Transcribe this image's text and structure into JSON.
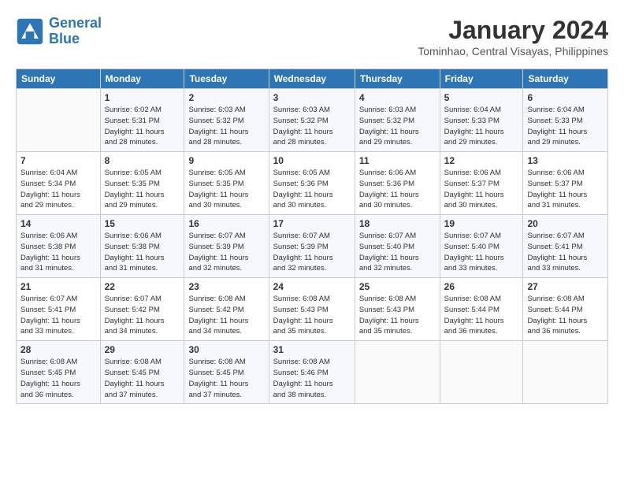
{
  "header": {
    "logo_line1": "General",
    "logo_line2": "Blue",
    "title": "January 2024",
    "subtitle": "Tominhao, Central Visayas, Philippines"
  },
  "columns": [
    "Sunday",
    "Monday",
    "Tuesday",
    "Wednesday",
    "Thursday",
    "Friday",
    "Saturday"
  ],
  "weeks": [
    [
      {
        "day": "",
        "info": ""
      },
      {
        "day": "1",
        "info": "Sunrise: 6:02 AM\nSunset: 5:31 PM\nDaylight: 11 hours\nand 28 minutes."
      },
      {
        "day": "2",
        "info": "Sunrise: 6:03 AM\nSunset: 5:32 PM\nDaylight: 11 hours\nand 28 minutes."
      },
      {
        "day": "3",
        "info": "Sunrise: 6:03 AM\nSunset: 5:32 PM\nDaylight: 11 hours\nand 28 minutes."
      },
      {
        "day": "4",
        "info": "Sunrise: 6:03 AM\nSunset: 5:32 PM\nDaylight: 11 hours\nand 29 minutes."
      },
      {
        "day": "5",
        "info": "Sunrise: 6:04 AM\nSunset: 5:33 PM\nDaylight: 11 hours\nand 29 minutes."
      },
      {
        "day": "6",
        "info": "Sunrise: 6:04 AM\nSunset: 5:33 PM\nDaylight: 11 hours\nand 29 minutes."
      }
    ],
    [
      {
        "day": "7",
        "info": "Sunrise: 6:04 AM\nSunset: 5:34 PM\nDaylight: 11 hours\nand 29 minutes."
      },
      {
        "day": "8",
        "info": "Sunrise: 6:05 AM\nSunset: 5:35 PM\nDaylight: 11 hours\nand 29 minutes."
      },
      {
        "day": "9",
        "info": "Sunrise: 6:05 AM\nSunset: 5:35 PM\nDaylight: 11 hours\nand 30 minutes."
      },
      {
        "day": "10",
        "info": "Sunrise: 6:05 AM\nSunset: 5:36 PM\nDaylight: 11 hours\nand 30 minutes."
      },
      {
        "day": "11",
        "info": "Sunrise: 6:06 AM\nSunset: 5:36 PM\nDaylight: 11 hours\nand 30 minutes."
      },
      {
        "day": "12",
        "info": "Sunrise: 6:06 AM\nSunset: 5:37 PM\nDaylight: 11 hours\nand 30 minutes."
      },
      {
        "day": "13",
        "info": "Sunrise: 6:06 AM\nSunset: 5:37 PM\nDaylight: 11 hours\nand 31 minutes."
      }
    ],
    [
      {
        "day": "14",
        "info": "Sunrise: 6:06 AM\nSunset: 5:38 PM\nDaylight: 11 hours\nand 31 minutes."
      },
      {
        "day": "15",
        "info": "Sunrise: 6:06 AM\nSunset: 5:38 PM\nDaylight: 11 hours\nand 31 minutes."
      },
      {
        "day": "16",
        "info": "Sunrise: 6:07 AM\nSunset: 5:39 PM\nDaylight: 11 hours\nand 32 minutes."
      },
      {
        "day": "17",
        "info": "Sunrise: 6:07 AM\nSunset: 5:39 PM\nDaylight: 11 hours\nand 32 minutes."
      },
      {
        "day": "18",
        "info": "Sunrise: 6:07 AM\nSunset: 5:40 PM\nDaylight: 11 hours\nand 32 minutes."
      },
      {
        "day": "19",
        "info": "Sunrise: 6:07 AM\nSunset: 5:40 PM\nDaylight: 11 hours\nand 33 minutes."
      },
      {
        "day": "20",
        "info": "Sunrise: 6:07 AM\nSunset: 5:41 PM\nDaylight: 11 hours\nand 33 minutes."
      }
    ],
    [
      {
        "day": "21",
        "info": "Sunrise: 6:07 AM\nSunset: 5:41 PM\nDaylight: 11 hours\nand 33 minutes."
      },
      {
        "day": "22",
        "info": "Sunrise: 6:07 AM\nSunset: 5:42 PM\nDaylight: 11 hours\nand 34 minutes."
      },
      {
        "day": "23",
        "info": "Sunrise: 6:08 AM\nSunset: 5:42 PM\nDaylight: 11 hours\nand 34 minutes."
      },
      {
        "day": "24",
        "info": "Sunrise: 6:08 AM\nSunset: 5:43 PM\nDaylight: 11 hours\nand 35 minutes."
      },
      {
        "day": "25",
        "info": "Sunrise: 6:08 AM\nSunset: 5:43 PM\nDaylight: 11 hours\nand 35 minutes."
      },
      {
        "day": "26",
        "info": "Sunrise: 6:08 AM\nSunset: 5:44 PM\nDaylight: 11 hours\nand 36 minutes."
      },
      {
        "day": "27",
        "info": "Sunrise: 6:08 AM\nSunset: 5:44 PM\nDaylight: 11 hours\nand 36 minutes."
      }
    ],
    [
      {
        "day": "28",
        "info": "Sunrise: 6:08 AM\nSunset: 5:45 PM\nDaylight: 11 hours\nand 36 minutes."
      },
      {
        "day": "29",
        "info": "Sunrise: 6:08 AM\nSunset: 5:45 PM\nDaylight: 11 hours\nand 37 minutes."
      },
      {
        "day": "30",
        "info": "Sunrise: 6:08 AM\nSunset: 5:45 PM\nDaylight: 11 hours\nand 37 minutes."
      },
      {
        "day": "31",
        "info": "Sunrise: 6:08 AM\nSunset: 5:46 PM\nDaylight: 11 hours\nand 38 minutes."
      },
      {
        "day": "",
        "info": ""
      },
      {
        "day": "",
        "info": ""
      },
      {
        "day": "",
        "info": ""
      }
    ]
  ]
}
